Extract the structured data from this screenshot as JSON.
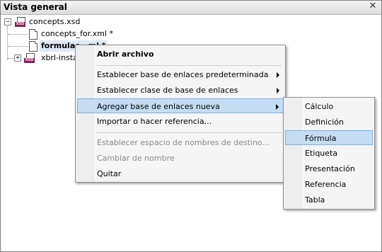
{
  "panel": {
    "title": "Vista general"
  },
  "tree": {
    "root": {
      "label": "concepts.xsd",
      "icon": "xsd-file-icon",
      "icon_tag": "XSD",
      "expander": "−"
    },
    "children": [
      {
        "label": "concepts_for.xml *",
        "icon": "document-icon"
      },
      {
        "label": "formulae",
        "label_suffix": "…ml *",
        "icon": "document-icon",
        "selected": true
      },
      {
        "label": "xbrl-instan",
        "icon": "xsd-file-icon",
        "icon_tag": "XSD",
        "expander": "+"
      }
    ]
  },
  "context_menu": {
    "items": [
      {
        "label": "Abrir archivo",
        "bold": true
      },
      {
        "separator": true
      },
      {
        "label": "Establecer base de enlaces predeterminada",
        "submenu": true
      },
      {
        "label": "Establecer clase de base de enlaces",
        "submenu": true
      },
      {
        "label": "Agregar base de enlaces nueva",
        "submenu": true,
        "highlighted": true
      },
      {
        "label": "Importar o hacer referencia..."
      },
      {
        "separator": true
      },
      {
        "label": "Establecer espacio de nombres de destino...",
        "disabled": true
      },
      {
        "label": "Cambiar de nombre",
        "disabled": true
      },
      {
        "label": "Quitar"
      }
    ]
  },
  "submenu": {
    "items": [
      {
        "label": "Cálculo"
      },
      {
        "label": "Definición"
      },
      {
        "label": "Fórmula",
        "highlighted": true
      },
      {
        "label": "Etiqueta"
      },
      {
        "label": "Presentación"
      },
      {
        "label": "Referencia"
      },
      {
        "label": "Tabla"
      }
    ]
  },
  "colors": {
    "highlight": "#c6dcf5",
    "highlight_border": "#7eaee0",
    "xsd_tag": "#8b1a5a"
  }
}
